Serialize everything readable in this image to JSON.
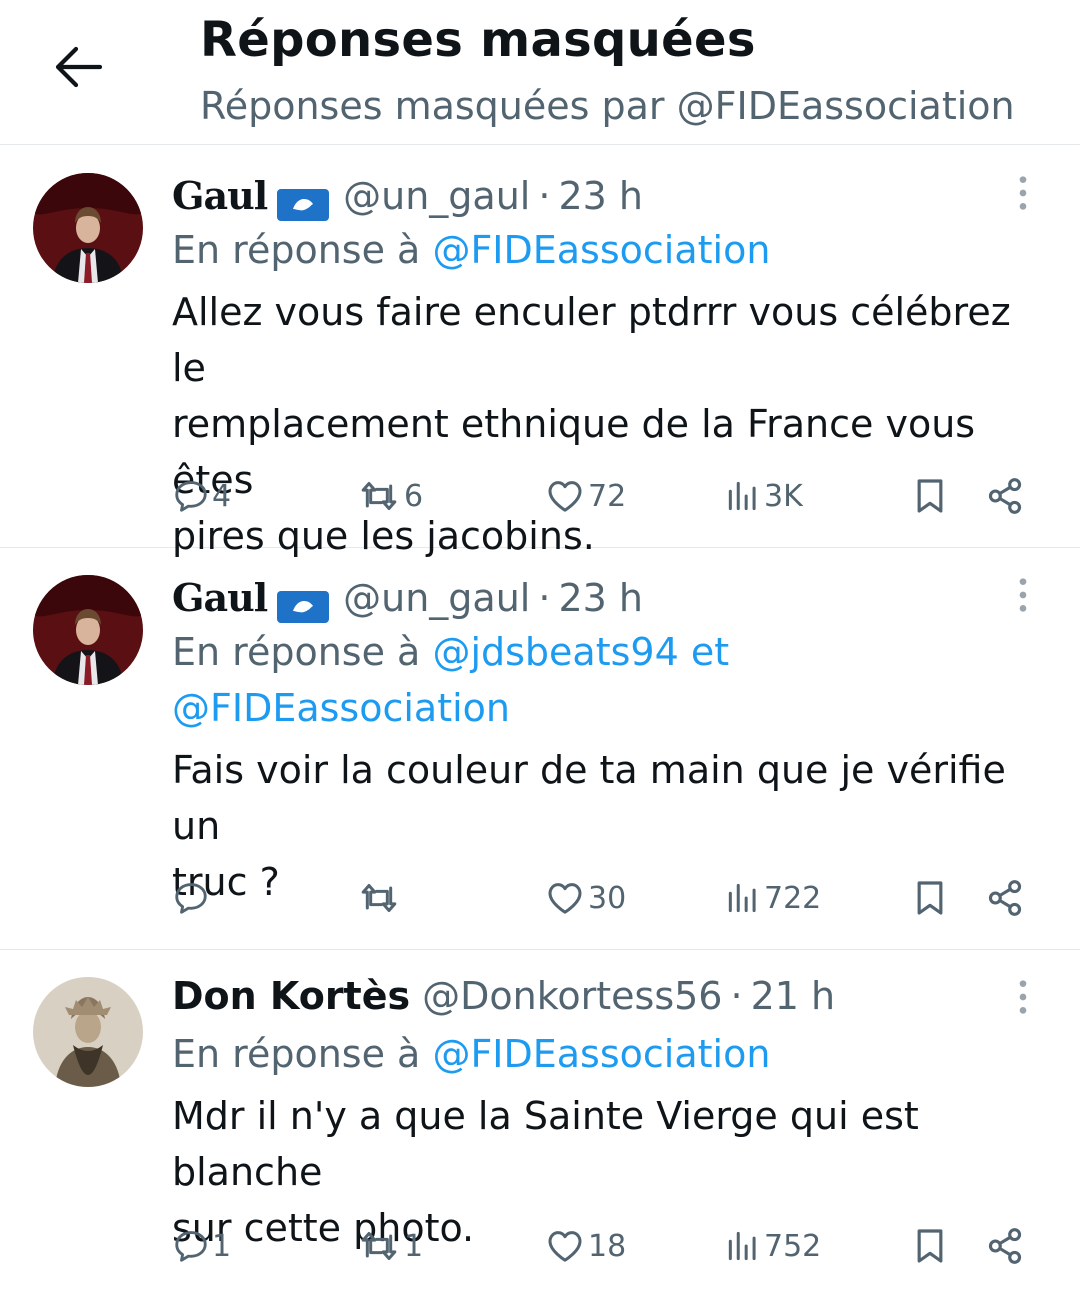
{
  "header": {
    "title": "Réponses masquées",
    "subtitle": "Réponses masquées par @FIDEassociation"
  },
  "tweets": [
    {
      "display_name": "Gaul",
      "handle": "@un_gaul",
      "separator": "·",
      "time": "23 h",
      "reply_prefix": "En réponse à",
      "mentions": [
        "@FIDEassociation"
      ],
      "text": "Allez vous faire enculer ptdrrr vous célébrez le\nremplacement ethnique de la France vous êtes\npires que les jacobins.",
      "counts": {
        "replies": "4",
        "retweets": "6",
        "likes": "72",
        "views": "3K"
      }
    },
    {
      "display_name": "Gaul",
      "handle": "@un_gaul",
      "separator": "·",
      "time": "23 h",
      "reply_prefix": "En réponse à",
      "mentions": [
        "@jdsbeats94",
        "@FIDEassociation"
      ],
      "mention_joiner": "et",
      "text": "Fais voir la couleur de ta main que je vérifie un\ntruc ?",
      "counts": {
        "replies": "",
        "retweets": "",
        "likes": "30",
        "views": "722"
      }
    },
    {
      "display_name": "Don Kortès",
      "handle": "@Donkortess56",
      "separator": "·",
      "time": "21 h",
      "reply_prefix": "En réponse à",
      "mentions": [
        "@FIDEassociation"
      ],
      "text": "Mdr il n'y a que la Sainte Vierge qui est blanche\nsur cette photo.",
      "counts": {
        "replies": "1",
        "retweets": "1",
        "likes": "18",
        "views": "752"
      }
    }
  ],
  "icons": {
    "back": "arrow-left-icon",
    "flag": "antarctica-flag-icon",
    "more": "three-dots-vertical-icon",
    "reply": "speech-bubble-icon",
    "retweet": "retweet-arrows-icon",
    "like": "heart-icon",
    "views": "bar-chart-icon",
    "bookmark": "bookmark-icon",
    "share": "share-icon"
  },
  "colors": {
    "text": "#0f1419",
    "secondary": "#536471",
    "link": "#1d9bf0",
    "divider": "#e6e9eb",
    "flag_blue": "#1e73c8"
  }
}
